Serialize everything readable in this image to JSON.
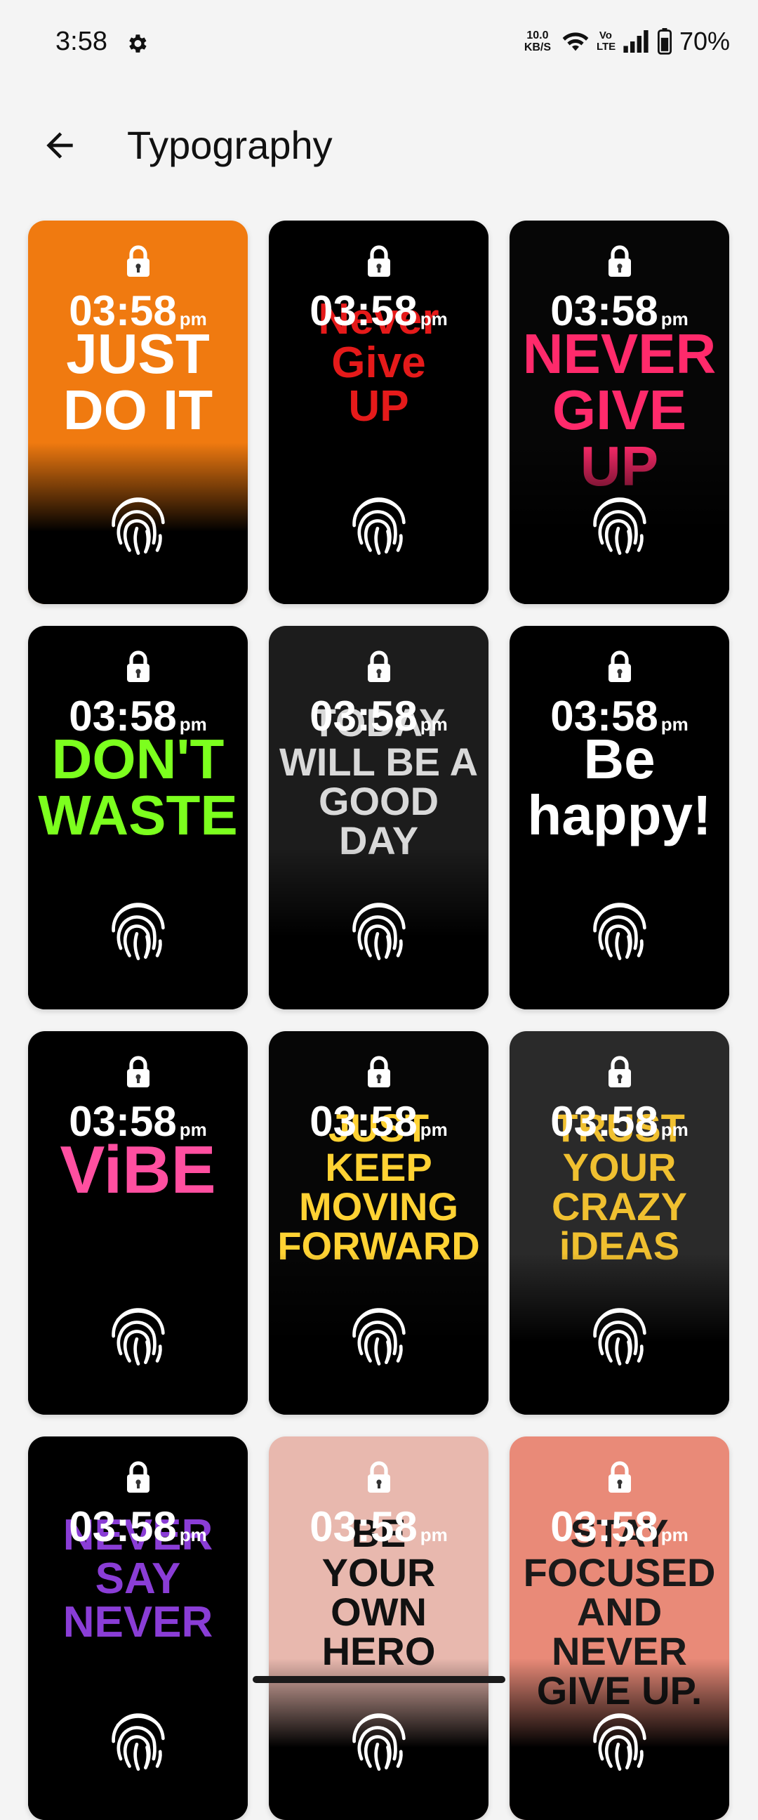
{
  "status": {
    "time": "3:58",
    "net_speed_value": "10.0",
    "net_speed_unit": "KB/S",
    "volte_top": "Vo",
    "volte_bottom": "LTE",
    "battery": "70%"
  },
  "header": {
    "title": "Typography",
    "back_icon": "arrow-left-icon"
  },
  "card_overlay": {
    "time": "03:58",
    "ampm": "pm",
    "lock_icon": "lock-icon",
    "fingerprint_icon": "fingerprint-icon"
  },
  "cards": [
    {
      "quote_lines": [
        "JUST",
        "DO IT"
      ],
      "bg": "#f07a10",
      "text_color": "#ffffff"
    },
    {
      "quote_lines": [
        "Never",
        "Give",
        "UP"
      ],
      "bg": "#000000",
      "text_color": "#e51a1a"
    },
    {
      "quote_lines": [
        "NEVER",
        "GIVE UP"
      ],
      "bg": "#060606",
      "text_color": "#ff2a6b"
    },
    {
      "quote_lines": [
        "DON'T",
        "WASTE"
      ],
      "bg": "#000000",
      "text_color": "#7cff1e"
    },
    {
      "quote_lines": [
        "TODAY",
        "WILL BE A",
        "GOOD",
        "DAY"
      ],
      "bg": "#1c1c1c",
      "text_color": "#d9d9d9"
    },
    {
      "quote_lines": [
        "Be",
        "happy!"
      ],
      "bg": "#000000",
      "text_color": "#ffffff"
    },
    {
      "quote_lines": [
        "ViBE"
      ],
      "bg": "#000000",
      "text_color": "#ff4fa0"
    },
    {
      "quote_lines": [
        "JUST",
        "KEEP",
        "MOVING",
        "FORWARD"
      ],
      "bg": "#060606",
      "text_color": "#ffd233"
    },
    {
      "quote_lines": [
        "TRUST",
        "YOUR",
        "CRAZY",
        "iDEAS"
      ],
      "bg": "#2a2a2a",
      "text_color": "#f0c030"
    },
    {
      "quote_lines": [
        "NEVER",
        "SAY",
        "NEVER"
      ],
      "bg": "#000000",
      "text_color": "#8a3dd6"
    },
    {
      "quote_lines": [
        "BE",
        "YOUR",
        "OWN",
        "HERO"
      ],
      "bg": "#e8b8ae",
      "text_color": "#111111"
    },
    {
      "quote_lines": [
        "STAY",
        "FOCUSED",
        "AND NEVER",
        "GIVE UP."
      ],
      "bg": "#e98a78",
      "text_color": "#1a1a1a"
    }
  ]
}
